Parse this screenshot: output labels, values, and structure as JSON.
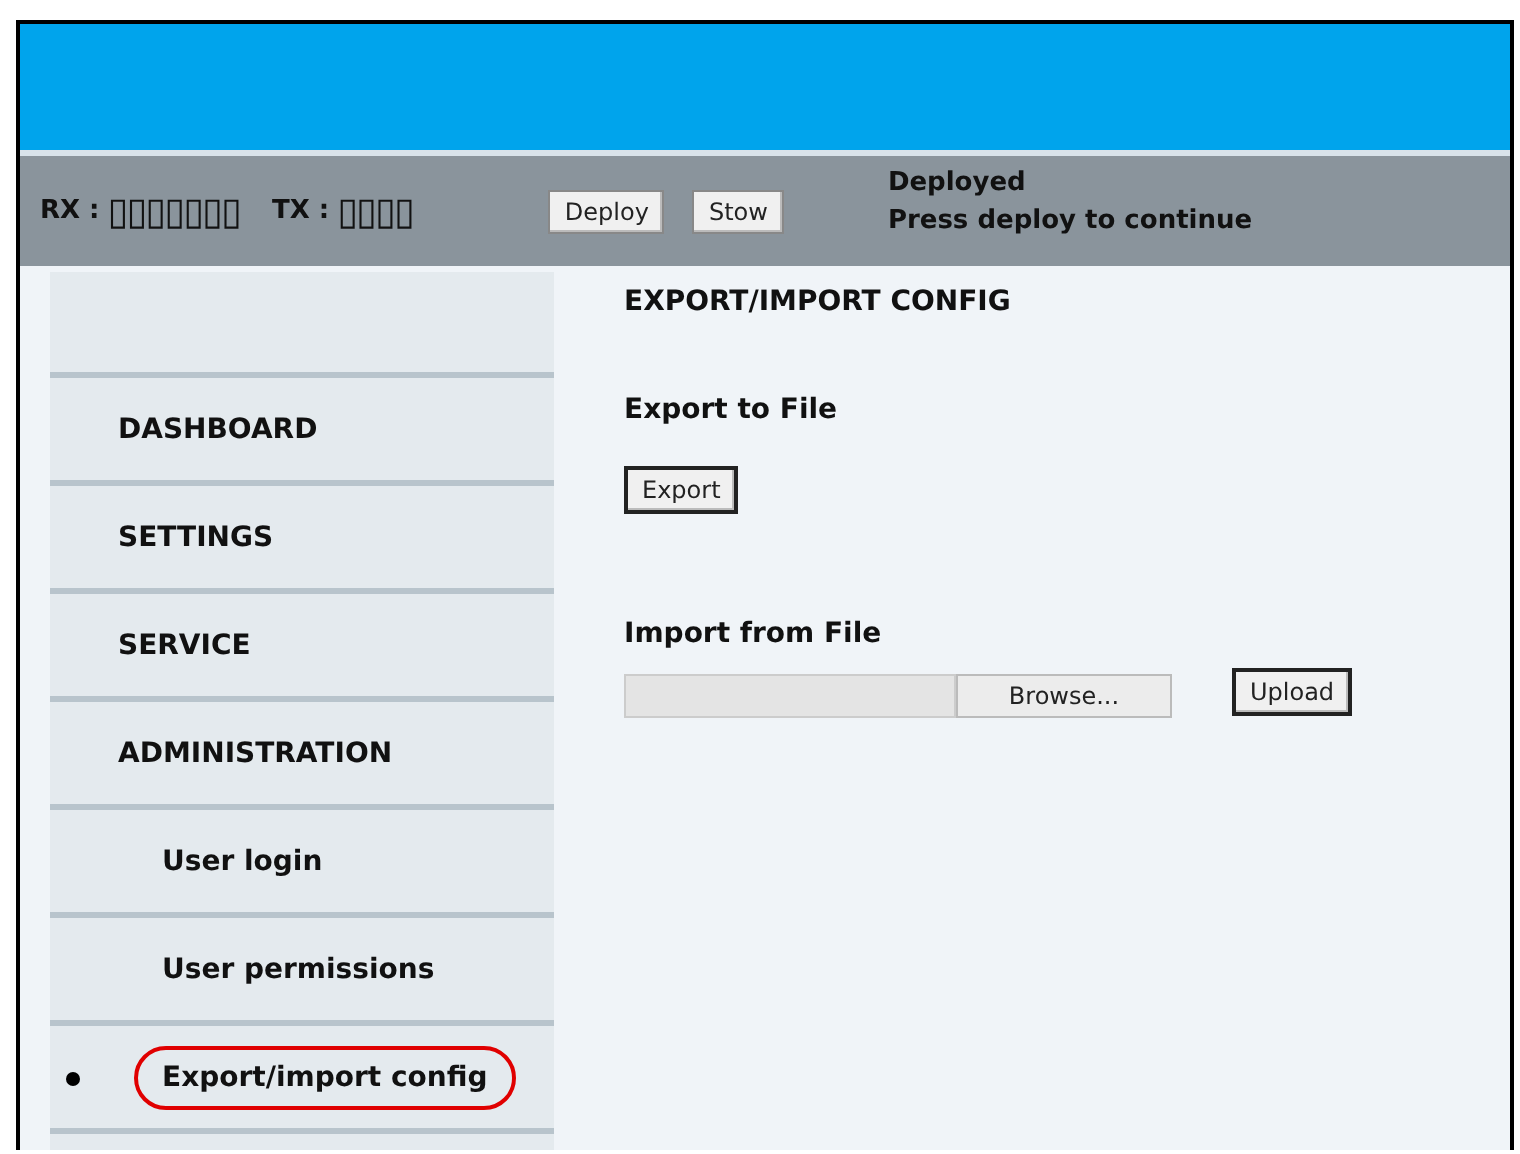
{
  "status_bar": {
    "rx_label": "RX :",
    "rx_value": "▯▯▯▯▯▯▯",
    "tx_label": "TX :",
    "tx_value": "▯▯▯▯",
    "buttons": [
      "Deploy",
      "Stow"
    ],
    "status_lines": [
      "Deployed",
      "Press deploy to continue"
    ]
  },
  "sidebar": {
    "items": [
      {
        "label": "DASHBOARD",
        "kind": "section",
        "selected": false
      },
      {
        "label": "SETTINGS",
        "kind": "section",
        "selected": false
      },
      {
        "label": "SERVICE",
        "kind": "section",
        "selected": false
      },
      {
        "label": "ADMINISTRATION",
        "kind": "section",
        "selected": false
      },
      {
        "label": "User login",
        "kind": "sub",
        "selected": false
      },
      {
        "label": "User permissions",
        "kind": "sub",
        "selected": false
      },
      {
        "label": "Export/import config",
        "kind": "sub",
        "selected": true
      }
    ]
  },
  "content": {
    "title": "EXPORT/IMPORT CONFIG",
    "export": {
      "heading": "Export to File",
      "button": "Export"
    },
    "import": {
      "heading": "Import from File",
      "browse_button": "Browse...",
      "upload_button": "Upload"
    }
  }
}
